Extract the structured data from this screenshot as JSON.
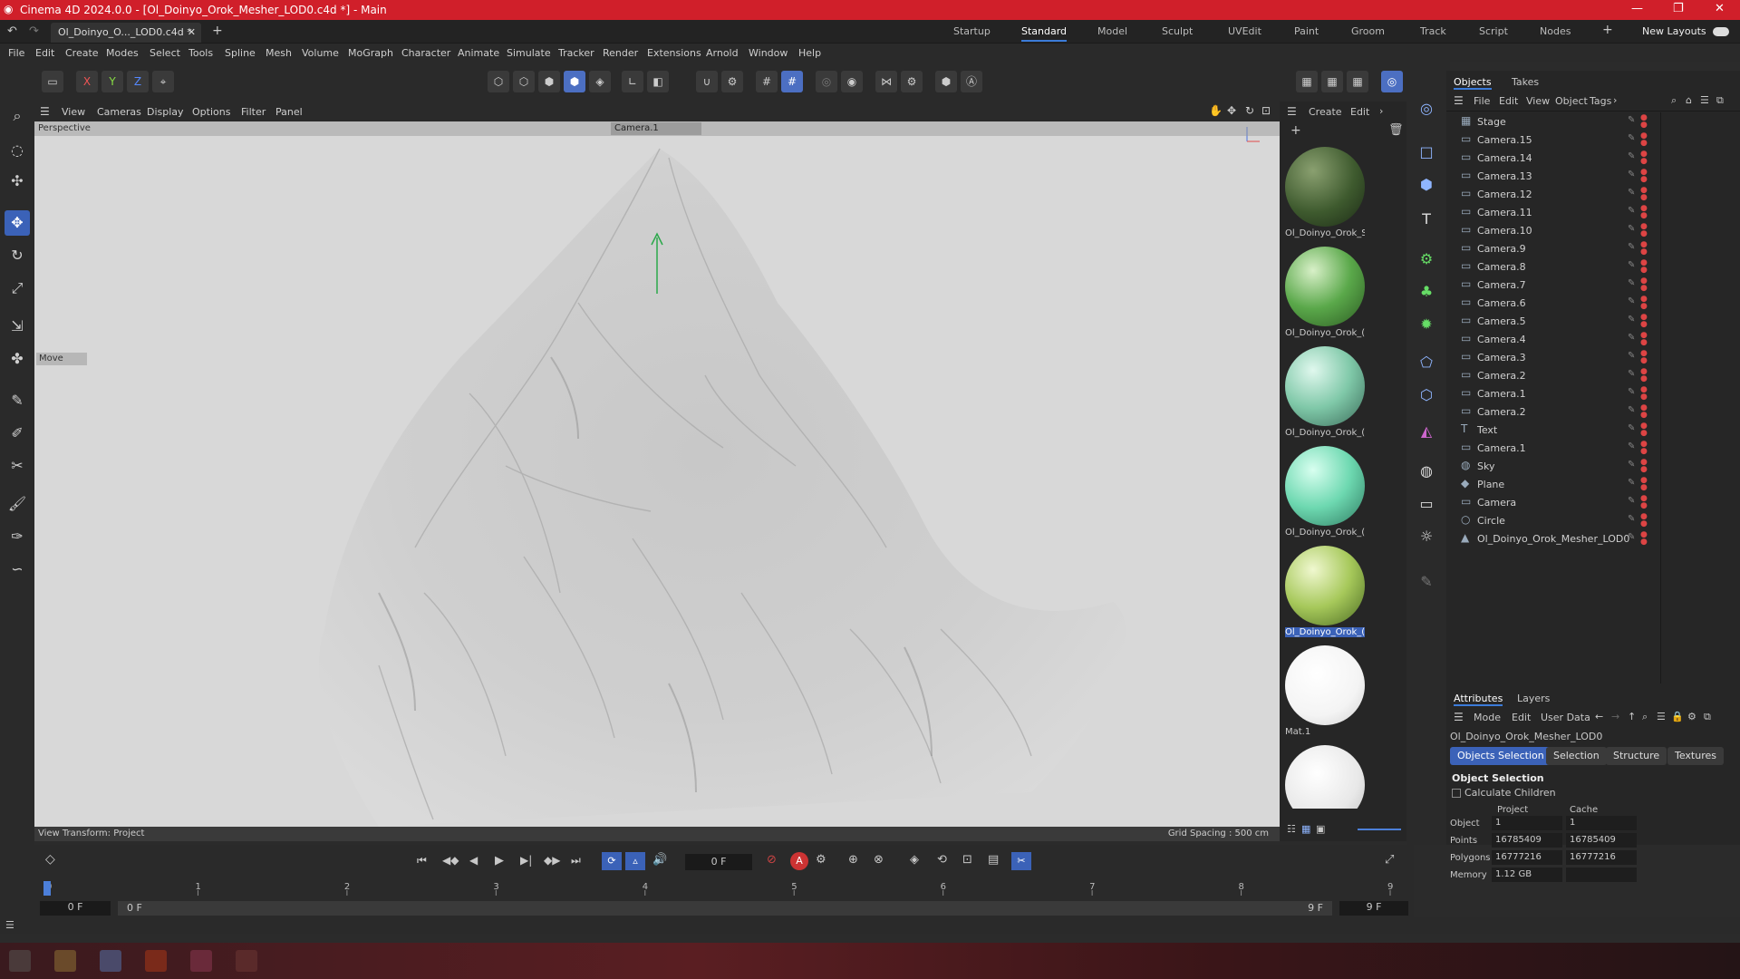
{
  "window": {
    "title": "Cinema 4D 2024.0.0 - [Ol_Doinyo_Orok_Mesher_LOD0.c4d *] - Main"
  },
  "doc_tab": "Ol_Doinyo_O..._LOD0.c4d *",
  "layouts": [
    "Startup",
    "Standard",
    "Model",
    "Sculpt",
    "UVEdit",
    "Paint",
    "Groom",
    "Track",
    "Script",
    "Nodes"
  ],
  "active_layout": "Standard",
  "new_layouts": "New Layouts",
  "menu": [
    "File",
    "Edit",
    "Create",
    "Modes",
    "Select",
    "Tools",
    "Spline",
    "Mesh",
    "Volume",
    "MoGraph",
    "Character",
    "Animate",
    "Simulate",
    "Tracker",
    "Render",
    "Extensions",
    "Arnold",
    "Window",
    "Help"
  ],
  "coords": [
    "X",
    "Y",
    "Z"
  ],
  "viewport": {
    "menu": [
      "View",
      "Cameras",
      "Display",
      "Options",
      "Filter",
      "Panel"
    ],
    "label": "Perspective",
    "camera": "Camera.1",
    "tool_hud": "Move",
    "view_transform": "View Transform: Project",
    "grid_spacing": "Grid Spacing : 500 cm"
  },
  "material_panel": {
    "menu": [
      "Create",
      "Edit"
    ],
    "materials": [
      {
        "label": "Ol_Doinyo_Orok_S",
        "color": "#4a6a3a"
      },
      {
        "label": "Ol_Doinyo_Orok_(",
        "color": "#5aa84a"
      },
      {
        "label": "Ol_Doinyo_Orok_(",
        "color": "#7fc8a8"
      },
      {
        "label": "Ol_Doinyo_Orok_(",
        "color": "#6dd8b0"
      },
      {
        "label": "Ol_Doinyo_Orok_(",
        "color": "#a6c85a"
      },
      {
        "label": "Mat.1",
        "color": "#ffffff"
      },
      {
        "label": "",
        "color": "#e8e8e8"
      }
    ]
  },
  "objects_panel": {
    "tabs": [
      "Objects",
      "Takes"
    ],
    "menu": [
      "File",
      "Edit",
      "View",
      "Object",
      "Tags"
    ],
    "items": [
      {
        "name": "Stage",
        "icon": "stage-icon"
      },
      {
        "name": "Camera.15",
        "icon": "camera-icon"
      },
      {
        "name": "Camera.14",
        "icon": "camera-icon"
      },
      {
        "name": "Camera.13",
        "icon": "camera-icon"
      },
      {
        "name": "Camera.12",
        "icon": "camera-icon"
      },
      {
        "name": "Camera.11",
        "icon": "camera-icon"
      },
      {
        "name": "Camera.10",
        "icon": "camera-icon"
      },
      {
        "name": "Camera.9",
        "icon": "camera-icon"
      },
      {
        "name": "Camera.8",
        "icon": "camera-icon"
      },
      {
        "name": "Camera.7",
        "icon": "camera-icon"
      },
      {
        "name": "Camera.6",
        "icon": "camera-icon"
      },
      {
        "name": "Camera.5",
        "icon": "camera-icon"
      },
      {
        "name": "Camera.4",
        "icon": "camera-icon"
      },
      {
        "name": "Camera.3",
        "icon": "camera-icon"
      },
      {
        "name": "Camera.2",
        "icon": "camera-icon"
      },
      {
        "name": "Camera.1",
        "icon": "camera-icon"
      },
      {
        "name": "Camera.2",
        "icon": "camera-icon"
      },
      {
        "name": "Text",
        "icon": "text-icon"
      },
      {
        "name": "Camera.1",
        "icon": "camera-icon"
      },
      {
        "name": "Sky",
        "icon": "sky-icon"
      },
      {
        "name": "Plane",
        "icon": "plane-icon"
      },
      {
        "name": "Camera",
        "icon": "camera-icon"
      },
      {
        "name": "Circle",
        "icon": "circle-icon"
      },
      {
        "name": "Ol_Doinyo_Orok_Mesher_LOD0",
        "icon": "mesh-icon"
      }
    ]
  },
  "attributes": {
    "tabs": [
      "Attributes",
      "Layers"
    ],
    "menu": [
      "Mode",
      "Edit",
      "User Data"
    ],
    "object_name": "Ol_Doinyo_Orok_Mesher_LOD0",
    "subtabs": [
      "Objects Selection",
      "Selection",
      "Structure",
      "Textures"
    ],
    "section": "Object Selection",
    "calc_children": "Calculate Children",
    "col_project": "Project",
    "col_cache": "Cache",
    "rows": [
      {
        "label": "Object",
        "project": "1",
        "cache": "1"
      },
      {
        "label": "Points",
        "project": "16785409",
        "cache": "16785409"
      },
      {
        "label": "Polygons",
        "project": "16777216",
        "cache": "16777216"
      },
      {
        "label": "Memory",
        "project": "1.12 GB",
        "cache": ""
      }
    ]
  },
  "timeline": {
    "frame": "0 F",
    "ticks": [
      "0",
      "1",
      "2",
      "3",
      "4",
      "5",
      "6",
      "7",
      "8",
      "9"
    ],
    "start": "0 F",
    "start2": "0 F",
    "end": "9 F",
    "end2": "9 F"
  }
}
